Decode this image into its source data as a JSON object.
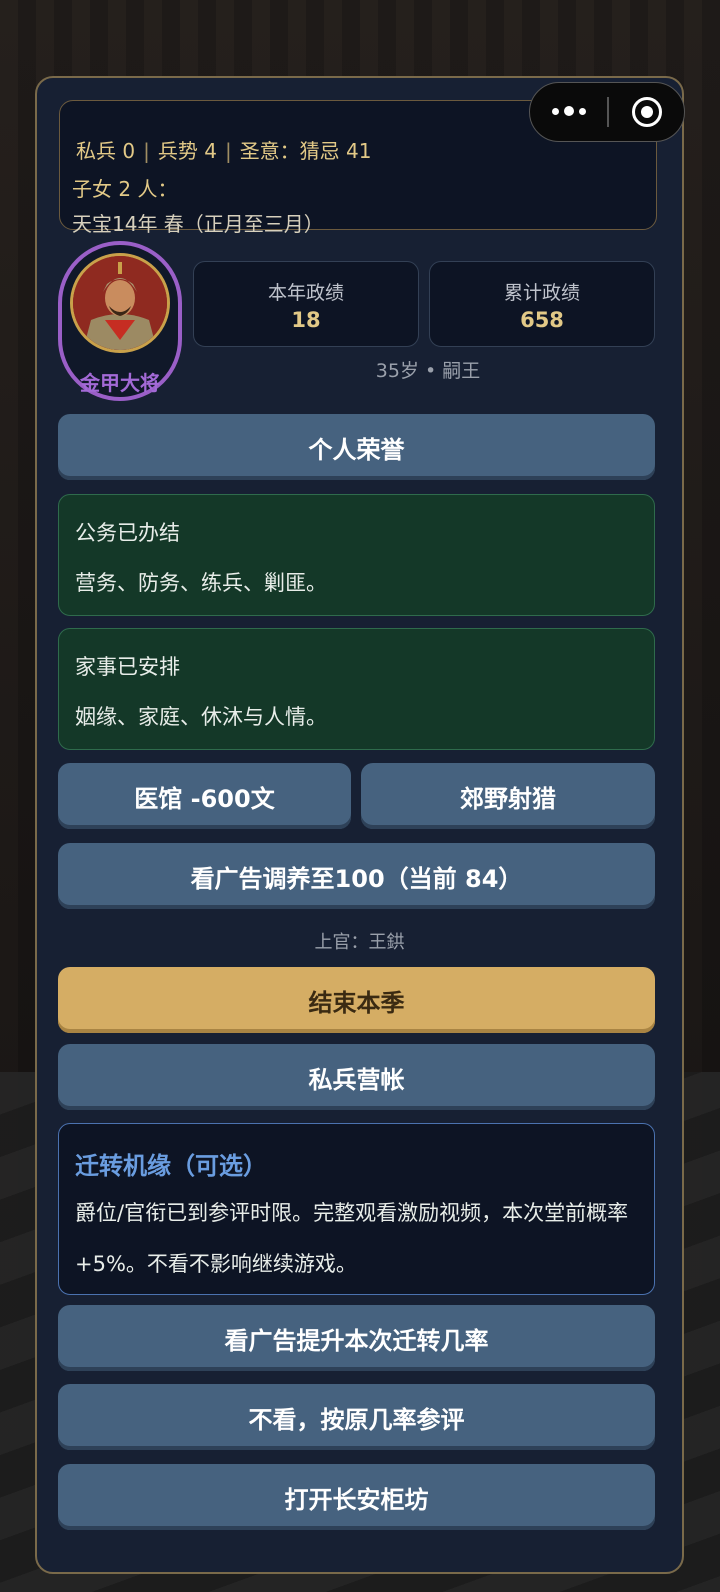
{
  "status": {
    "private_troops_label": "私兵",
    "private_troops": "0",
    "military_label": "兵势",
    "military": "4",
    "imperial_will_label": "圣意：猜忌",
    "imperial_will": "41",
    "children": "子女 2 人：",
    "date": "天宝14年 春（正月至三月）"
  },
  "avatar": {
    "title": "金甲大将"
  },
  "stats": {
    "this_year_label": "本年政绩",
    "this_year_value": "18",
    "total_label": "累计政绩",
    "total_value": "658",
    "age_rank": "35岁 • 嗣王"
  },
  "buttons": {
    "honors": "个人荣誉",
    "clinic": "医馆 -600文",
    "hunt": "郊野射猎",
    "recover_ad": "看广告调养至100（当前 84）",
    "end_season": "结束本季",
    "camp": "私兵营帐",
    "boost_ad": "看广告提升本次迁转几率",
    "skip_ad": "不看，按原几率参评",
    "shop": "打开长安柜坊"
  },
  "affairs": {
    "official_title": "公务已办结",
    "official_items": "营务、防务、练兵、剿匪。",
    "family_title": "家事已安排",
    "family_items": "姻缘、家庭、休沐与人情。"
  },
  "superior": "上官：王鉷",
  "promotion": {
    "title": "迁转机缘（可选）",
    "body": "爵位/官衔已到参评时限。完整观看激励视频，本次堂前概率 +5%。不看不影响继续游戏。"
  },
  "colors": {
    "panel": "#172033",
    "accent_gold": "#e2c987",
    "button": "#46627f",
    "button_gold": "#d5ad64",
    "green_box": "#143828",
    "avatar_ring": "#9a5fc7",
    "promotion_title": "#6a9de0"
  },
  "icons": [
    "more-dots-icon",
    "close-target-icon",
    "general-portrait"
  ]
}
